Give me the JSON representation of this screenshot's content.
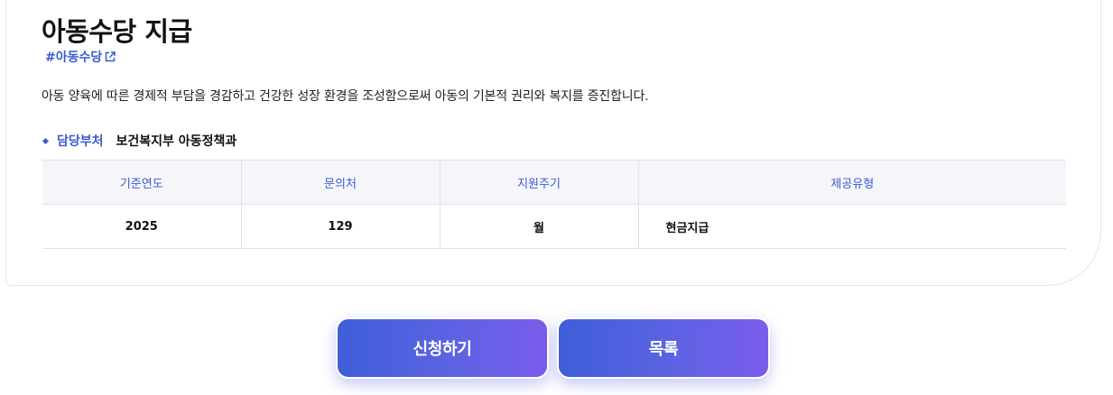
{
  "benefit": {
    "title": "아동수당 지급",
    "hashtag": "#아동수당",
    "description": "아동 양육에 따른 경제적 부담을 경감하고 건강한 성장 환경을 조성함으로써 아동의 기본적 권리와 복지를 증진합니다.",
    "department_label": "담당부처",
    "department": "보건복지부 아동정책과"
  },
  "table": {
    "headers": [
      "기준연도",
      "문의처",
      "지원주기",
      "제공유형"
    ],
    "row": [
      "2025",
      "129",
      "월",
      "현금지급"
    ]
  },
  "actions": {
    "apply_label": "신청하기",
    "list_label": "목록"
  },
  "colors": {
    "accent": "#3c5bd0",
    "button_gradient_start": "#3f5ed8",
    "button_gradient_end": "#7a5ceb",
    "table_header_bg": "#f5f6fa"
  },
  "icons": {
    "hashtag_link": "external-link-icon"
  }
}
